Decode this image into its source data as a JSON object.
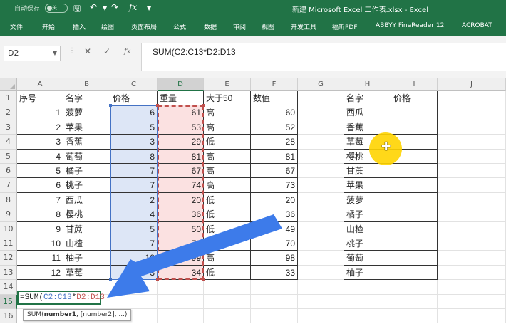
{
  "titlebar": {
    "autosave_label": "自动保存",
    "autosave_state": "关",
    "window_title": "新建 Microsoft Excel 工作表.xlsx  -  Excel",
    "accent_color": "#217346"
  },
  "ribbon": {
    "tabs": [
      "文件",
      "开始",
      "插入",
      "绘图",
      "页面布局",
      "公式",
      "数据",
      "审阅",
      "视图",
      "开发工具",
      "福昕PDF",
      "ABBYY FineReader 12",
      "ACROBAT"
    ]
  },
  "formula_bar": {
    "name_box": "D2",
    "formula": "=SUM(C2:C13*D2:D13"
  },
  "sheet": {
    "columns": [
      "A",
      "B",
      "C",
      "D",
      "E",
      "F",
      "G",
      "H",
      "I",
      "J"
    ],
    "rows": [
      "1",
      "2",
      "3",
      "4",
      "5",
      "6",
      "7",
      "8",
      "9",
      "10",
      "11",
      "12",
      "13",
      "14",
      "15",
      "16"
    ],
    "header_row": {
      "A": "序号",
      "B": "名字",
      "C": "价格",
      "D": "重量",
      "E": "大于50",
      "F": "数值"
    },
    "data_rows": [
      {
        "A": "1",
        "B": "菠萝",
        "C": "6",
        "D": "61",
        "E": "高",
        "F": "60"
      },
      {
        "A": "2",
        "B": "苹果",
        "C": "5",
        "D": "53",
        "E": "高",
        "F": "52"
      },
      {
        "A": "3",
        "B": "香蕉",
        "C": "3",
        "D": "29",
        "E": "低",
        "F": "28"
      },
      {
        "A": "4",
        "B": "葡萄",
        "C": "8",
        "D": "81",
        "E": "高",
        "F": "81"
      },
      {
        "A": "5",
        "B": "橘子",
        "C": "7",
        "D": "67",
        "E": "高",
        "F": "67"
      },
      {
        "A": "6",
        "B": "桃子",
        "C": "7",
        "D": "74",
        "E": "高",
        "F": "73"
      },
      {
        "A": "7",
        "B": "西瓜",
        "C": "2",
        "D": "20",
        "E": "低",
        "F": "20"
      },
      {
        "A": "8",
        "B": "樱桃",
        "C": "4",
        "D": "36",
        "E": "低",
        "F": "36"
      },
      {
        "A": "9",
        "B": "甘蔗",
        "C": "5",
        "D": "50",
        "E": "低",
        "F": "49"
      },
      {
        "A": "10",
        "B": "山楂",
        "C": "7",
        "D": "70",
        "E": "高",
        "F": "70"
      },
      {
        "A": "11",
        "B": "柚子",
        "C": "10",
        "D": "99",
        "E": "高",
        "F": "98"
      },
      {
        "A": "12",
        "B": "草莓",
        "C": "3",
        "D": "34",
        "E": "低",
        "F": "33"
      }
    ],
    "side_table": {
      "headers": [
        "名字",
        "价格"
      ],
      "names": [
        "西瓜",
        "香蕉",
        "草莓",
        "樱桃",
        "甘蔗",
        "苹果",
        "菠萝",
        "橘子",
        "山楂",
        "桃子",
        "葡萄",
        "柚子"
      ]
    },
    "editing_cell": {
      "prefix": "=SUM(",
      "ref_c": "C2:C13",
      "op": "*",
      "ref_d": "D2:D13"
    },
    "tooltip": {
      "func": "SUM(",
      "arg1": "number1",
      "rest": ", [number2], ...)"
    }
  }
}
